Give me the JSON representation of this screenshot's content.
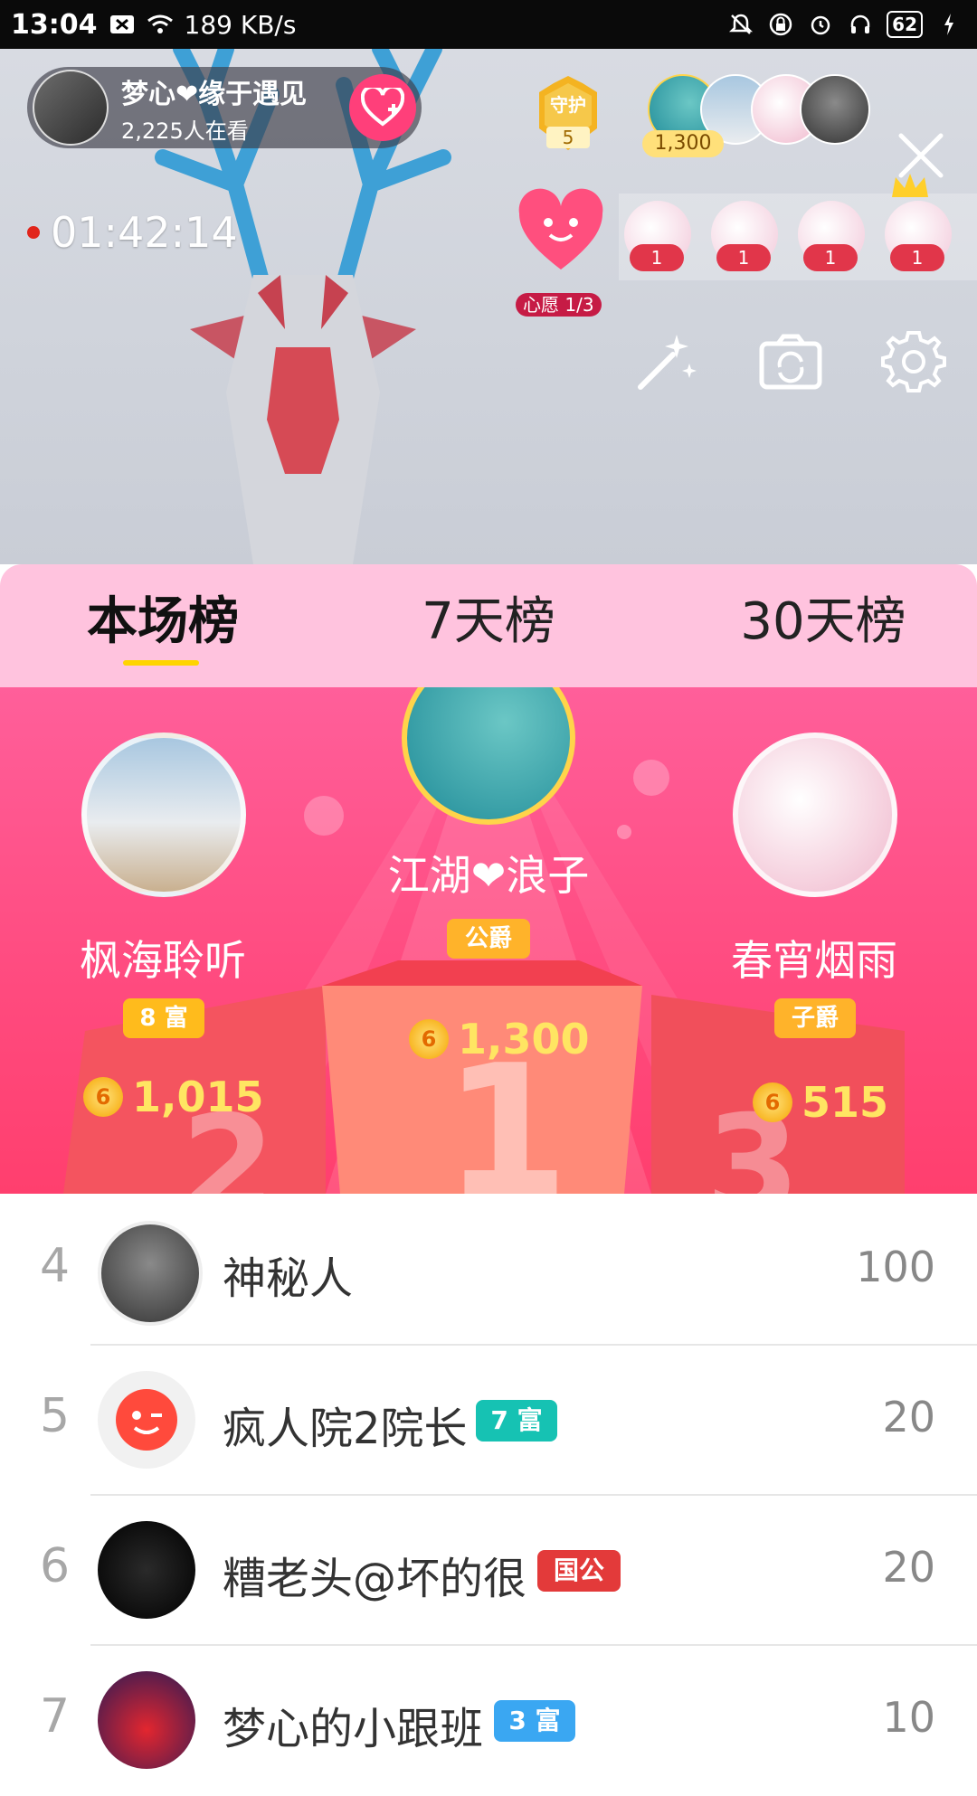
{
  "status_bar": {
    "time": "13:04",
    "speed": "189 KB/s",
    "battery": "62"
  },
  "live": {
    "host_name": "梦心❤缘于遇见",
    "viewer_count": "2,225人在看",
    "guard_label": "守护",
    "guard_count": "5",
    "top_coins": "1,300",
    "timer": "01:42:14",
    "wish_label": "心愿 1/3",
    "fan_counts": [
      "1",
      "1",
      "1",
      "1"
    ]
  },
  "tabs": [
    "本场榜",
    "7天榜",
    "30天榜"
  ],
  "podium": [
    {
      "rank": "1",
      "name": "江湖❤浪子",
      "tag": "公爵",
      "score": "1,300"
    },
    {
      "rank": "2",
      "name": "枫海聆听",
      "tag": "8 富",
      "score": "1,015"
    },
    {
      "rank": "3",
      "name": "春宵烟雨",
      "tag": "子爵",
      "score": "515"
    }
  ],
  "list": [
    {
      "rank": "4",
      "name": "神秘人",
      "badge": "",
      "score": "100"
    },
    {
      "rank": "5",
      "name": "疯人院2院长",
      "badge": "7 富",
      "score": "20"
    },
    {
      "rank": "6",
      "name": "糟老头@坏的很",
      "badge": "国公",
      "score": "20"
    },
    {
      "rank": "7",
      "name": "梦心的小跟班",
      "badge": "3 富",
      "score": "10"
    }
  ],
  "colors": {
    "accent_pink": "#ff4a7e",
    "tab_bg": "#ffc3de",
    "coin_yellow": "#ffe562",
    "badge_teal": "#16c2b3",
    "badge_blue": "#3aa7f2"
  }
}
